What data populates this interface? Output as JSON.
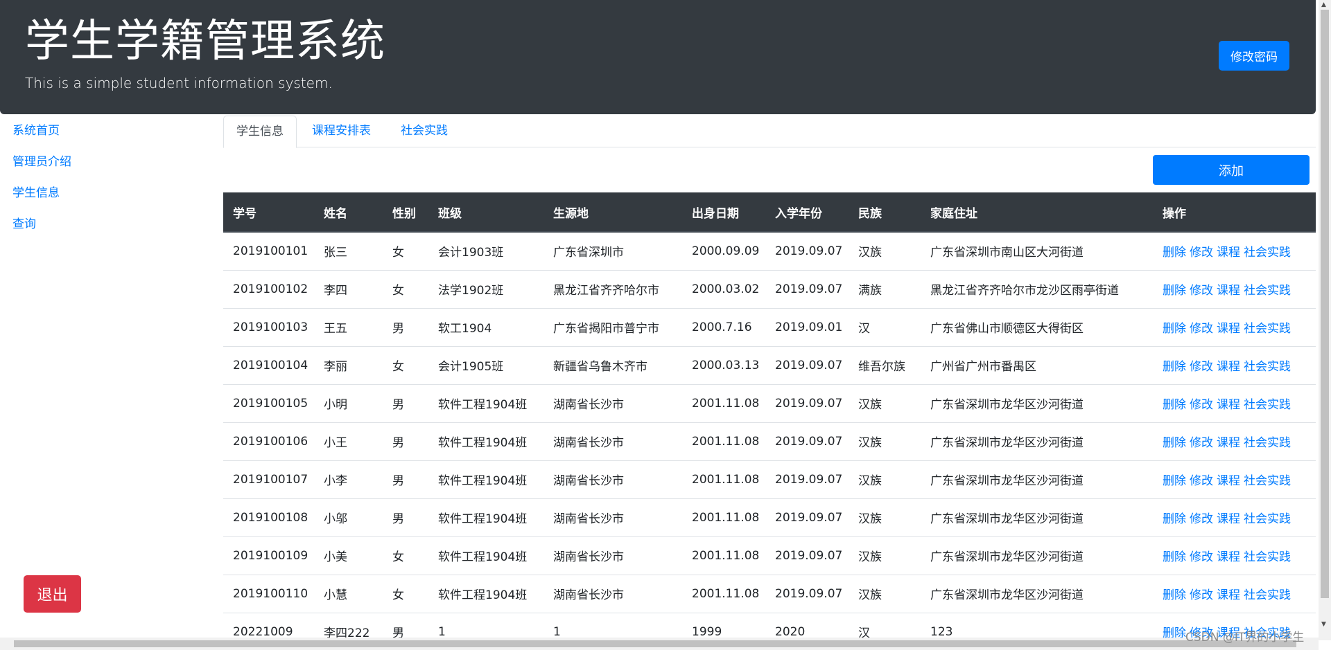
{
  "header": {
    "title": "学生学籍管理系统",
    "subtitle": "This is a simple student information system.",
    "change_password_label": "修改密码"
  },
  "sidebar": {
    "items": [
      {
        "label": "系统首页"
      },
      {
        "label": "管理员介绍"
      },
      {
        "label": "学生信息"
      },
      {
        "label": "查询"
      }
    ],
    "logout_label": "退出"
  },
  "tabs": [
    {
      "label": "学生信息",
      "active": true
    },
    {
      "label": "课程安排表",
      "active": false
    },
    {
      "label": "社会实践",
      "active": false
    }
  ],
  "add_label": "添加",
  "table": {
    "columns": [
      "学号",
      "姓名",
      "性别",
      "班级",
      "生源地",
      "出身日期",
      "入学年份",
      "民族",
      "家庭住址",
      "操作"
    ],
    "actions": [
      "删除",
      "修改",
      "课程",
      "社会实践"
    ],
    "rows": [
      [
        "2019100101",
        "张三",
        "女",
        "会计1903班",
        "广东省深圳市",
        "2000.09.09",
        "2019.09.07",
        "汉族",
        "广东省深圳市南山区大河街道"
      ],
      [
        "2019100102",
        "李四",
        "女",
        "法学1902班",
        "黑龙江省齐齐哈尔市",
        "2000.03.02",
        "2019.09.07",
        "满族",
        "黑龙江省齐齐哈尔市龙沙区雨亭街道"
      ],
      [
        "2019100103",
        "王五",
        "男",
        "软工1904",
        "广东省揭阳市普宁市",
        "2000.7.16",
        "2019.09.01",
        "汉",
        "广东省佛山市顺德区大得街区"
      ],
      [
        "2019100104",
        "李丽",
        "女",
        "会计1905班",
        "新疆省乌鲁木齐市",
        "2000.03.13",
        "2019.09.07",
        "维吾尔族",
        "广州省广州市番禺区"
      ],
      [
        "2019100105",
        "小明",
        "男",
        "软件工程1904班",
        "湖南省长沙市",
        "2001.11.08",
        "2019.09.07",
        "汉族",
        "广东省深圳市龙华区沙河街道"
      ],
      [
        "2019100106",
        "小王",
        "男",
        "软件工程1904班",
        "湖南省长沙市",
        "2001.11.08",
        "2019.09.07",
        "汉族",
        "广东省深圳市龙华区沙河街道"
      ],
      [
        "2019100107",
        "小李",
        "男",
        "软件工程1904班",
        "湖南省长沙市",
        "2001.11.08",
        "2019.09.07",
        "汉族",
        "广东省深圳市龙华区沙河街道"
      ],
      [
        "2019100108",
        "小邬",
        "男",
        "软件工程1904班",
        "湖南省长沙市",
        "2001.11.08",
        "2019.09.07",
        "汉族",
        "广东省深圳市龙华区沙河街道"
      ],
      [
        "2019100109",
        "小美",
        "女",
        "软件工程1904班",
        "湖南省长沙市",
        "2001.11.08",
        "2019.09.07",
        "汉族",
        "广东省深圳市龙华区沙河街道"
      ],
      [
        "2019100110",
        "小慧",
        "女",
        "软件工程1904班",
        "湖南省长沙市",
        "2001.11.08",
        "2019.09.07",
        "汉族",
        "广东省深圳市龙华区沙河街道"
      ],
      [
        "20221009",
        "李四222",
        "男",
        "1",
        "1",
        "1999",
        "2020",
        "汉",
        "123"
      ]
    ]
  },
  "watermark": "CSDN @IT界的小学生"
}
